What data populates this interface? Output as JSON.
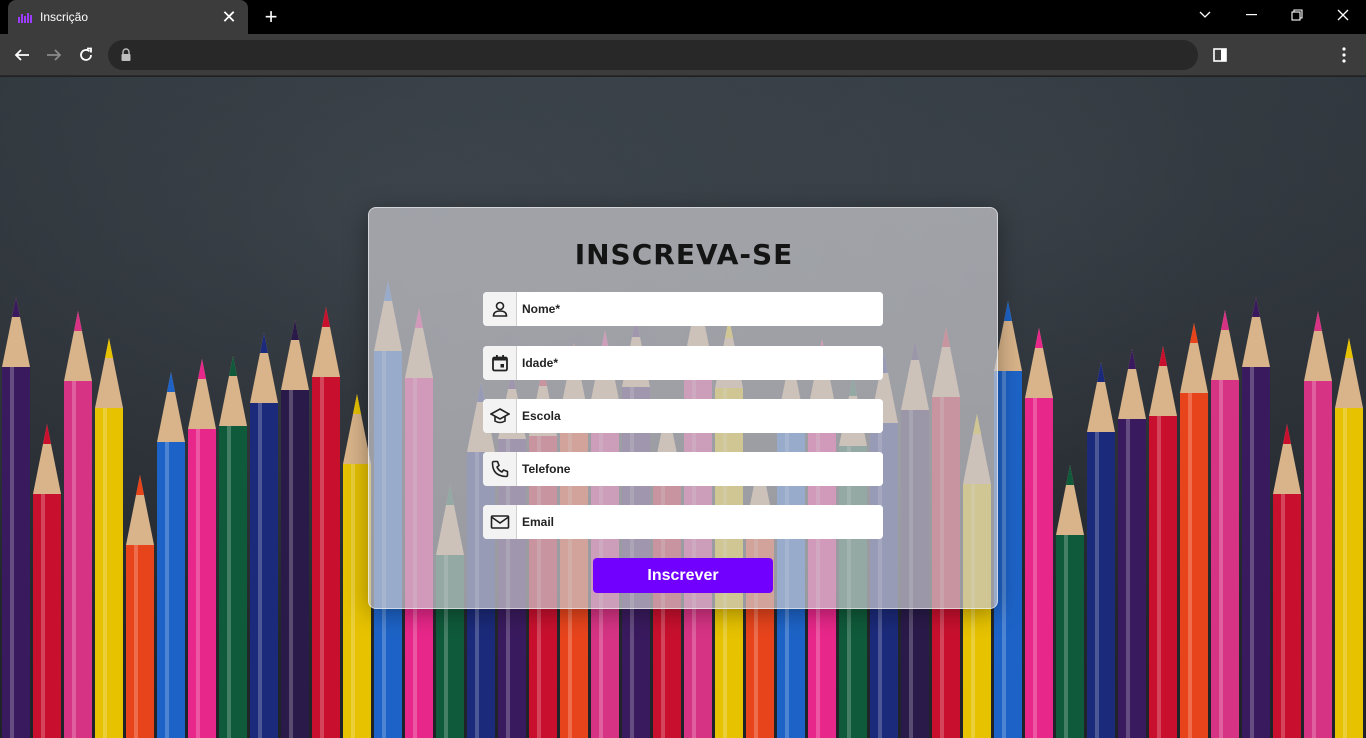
{
  "browser": {
    "tab_title": "Inscrição",
    "new_tab_symbol": "+",
    "close_symbol": "✕",
    "favicon_color": "#9b3cff"
  },
  "page": {
    "heading": "INSCREVA-SE",
    "fields": [
      {
        "icon": "user-icon",
        "placeholder": "Nome*"
      },
      {
        "icon": "calendar-icon",
        "placeholder": "Idade*"
      },
      {
        "icon": "graduation-cap-icon",
        "placeholder": "Escola"
      },
      {
        "icon": "phone-icon",
        "placeholder": "Telefone"
      },
      {
        "icon": "mail-icon",
        "placeholder": "Email"
      }
    ],
    "submit_label": "Inscrever",
    "accent_color": "#7100ff"
  }
}
